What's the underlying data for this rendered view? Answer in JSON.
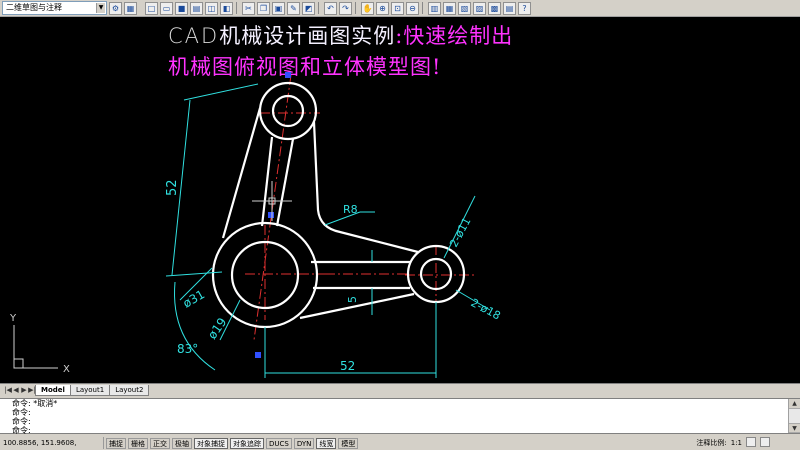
{
  "toolbar": {
    "workspace": "二维草图与注释",
    "icons": [
      "new-icon",
      "open-icon",
      "save-icon",
      "print-icon",
      "preview-icon",
      "publish-icon",
      "cut-icon",
      "copy-icon",
      "paste-icon",
      "match-icon",
      "block-editor-icon",
      "undo-icon",
      "redo-icon",
      "pan-icon",
      "zoom-realtime-icon",
      "zoom-window-icon",
      "zoom-previous-icon",
      "properties-icon",
      "design-center-icon",
      "tool-palette-icon",
      "sheet-set-icon",
      "markup-icon",
      "calculator-icon",
      "help-icon"
    ]
  },
  "title": {
    "line1_prefix": "CAD",
    "line1_middle": "机械设计画图实例",
    "line1_suffix": ":快速绘制出",
    "line2": "机械图俯视图和立体模型图!"
  },
  "dims": {
    "d52_vertical": "52",
    "r8": "R8",
    "d2phi11": "2-ø11",
    "d5": "5",
    "d2phi18": "2-ø18",
    "phi31": "ø31",
    "phi19": "ø19",
    "angle83": "83°",
    "d52_horizontal": "52"
  },
  "ucs": {
    "x": "X",
    "y": "Y"
  },
  "tabs": {
    "model": "Model",
    "layout1": "Layout1",
    "layout2": "Layout2"
  },
  "command": {
    "line1": "命令: *取消*",
    "line2": "命令:",
    "line3": "命令:",
    "line4": "命令:"
  },
  "status": {
    "coords": "100.8856, 151.9608, 0.0000",
    "buttons": [
      "捕捉",
      "栅格",
      "正交",
      "极轴",
      "对象捕捉",
      "对象追踪",
      "DUCS",
      "DYN",
      "线宽",
      "模型"
    ],
    "annotation_scale_label": "注释比例:",
    "annotation_scale_value": "1:1"
  },
  "colors": {
    "background": "#000000",
    "object_lines": "#ffffff",
    "dimensions": "#30e0e0",
    "centerlines": "#e03030",
    "title_magenta": "#ff33ff"
  }
}
